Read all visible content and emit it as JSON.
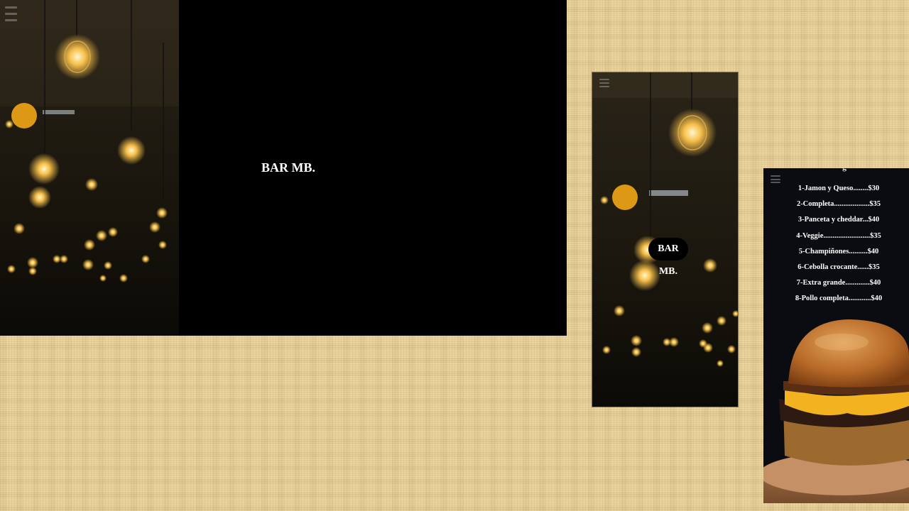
{
  "desktop": {
    "menu_icon": "hamburger-icon",
    "title": "BAR MB."
  },
  "mobile": {
    "menu_icon": "hamburger-icon",
    "title": "BAR MB."
  },
  "menu": {
    "menu_icon": "hamburger-icon",
    "top_fragment": "g",
    "items": [
      "1-Jamon y Queso........$30",
      "2-Completa...................$35",
      "3-Panceta y cheddar...$40",
      "4-Veggie.........................$35",
      "5-Champiñones..........$40",
      "6-Cebolla crocante......$35",
      "7-Extra grande.............$40",
      "8-Pollo completa............$40"
    ]
  },
  "colors": {
    "page_background": "#e6cf97",
    "panel_background": "#000000",
    "menu_background": "#0b0c12",
    "bulb_glow": "#f5b93a"
  }
}
